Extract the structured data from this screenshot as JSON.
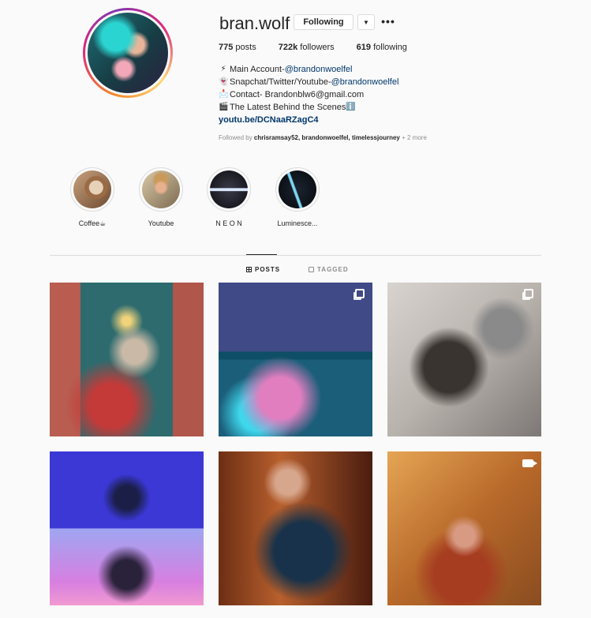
{
  "profile": {
    "username": "bran.wolf",
    "follow_label": "Following",
    "dropdown_glyph": "▼",
    "more_glyph": "•••",
    "stats": [
      {
        "count": "775",
        "label": "posts"
      },
      {
        "count": "722k",
        "label": "followers"
      },
      {
        "count": "619",
        "label": "following"
      }
    ],
    "bio": [
      {
        "emoji": "⚡",
        "text": "Main Account- ",
        "handle": "@brandonwoelfel"
      },
      {
        "emoji": "👻",
        "text": "Snapchat/Twitter/Youtube- ",
        "handle": "@brandonwoelfel"
      },
      {
        "emoji": "📩",
        "text": "Contact- Brandonblw6@gmail.com",
        "handle": ""
      },
      {
        "emoji": "🎬",
        "text": "The Latest Behind the Scenes",
        "handle": "ℹ️"
      }
    ],
    "bio_link": "youtu.be/DCNaaRZagC4",
    "followed_by_prefix": "Followed by ",
    "followed_by_names": "chrisramsay52, brandonwoelfel, timelessjourney",
    "followed_by_more": " + 2 more"
  },
  "highlights": [
    {
      "label": "Coffee☕",
      "icon": "coffee-highlight"
    },
    {
      "label": "Youtube",
      "icon": "youtube-highlight"
    },
    {
      "label": "N E O N",
      "icon": "neon-highlight"
    },
    {
      "label": "Luminesce...",
      "icon": "luminesce-highlight"
    }
  ],
  "tabs": {
    "posts": "POSTS",
    "tagged": "TAGGED"
  },
  "posts": [
    {
      "type": "photo"
    },
    {
      "type": "carousel"
    },
    {
      "type": "carousel"
    },
    {
      "type": "photo"
    },
    {
      "type": "photo"
    },
    {
      "type": "video"
    }
  ],
  "colors": {
    "link": "#00376b",
    "muted": "#8e8e8e",
    "border": "#dbdbdb",
    "text": "#262626"
  }
}
